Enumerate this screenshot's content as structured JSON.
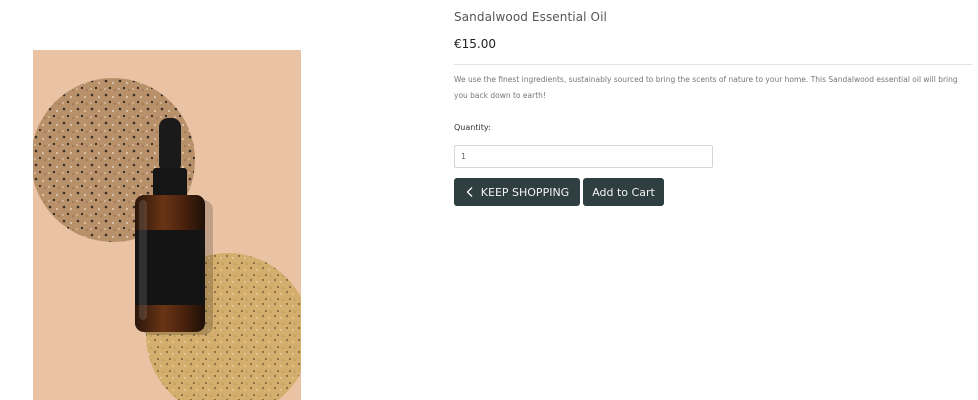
{
  "product": {
    "title": "Sandalwood Essential Oil",
    "price": "€15.00",
    "description": "We use the finest ingredients, sustainably sourced to bring the scents of nature to your home. This Sandalwood essential oil will bring you back down to earth!",
    "image_alt": "Amber dropper bottle of sandalwood essential oil on terrazzo stones"
  },
  "quantity": {
    "label": "Quantity:",
    "value": "1"
  },
  "actions": {
    "keep_shopping_label": "KEEP SHOPPING",
    "add_to_cart_label": "Add to Cart",
    "keep_shopping_icon": "chevron-left-icon"
  },
  "colors": {
    "button_bg": "#2f3e40",
    "button_text": "#f2f2f2",
    "image_bg": "#e9c3a4"
  }
}
